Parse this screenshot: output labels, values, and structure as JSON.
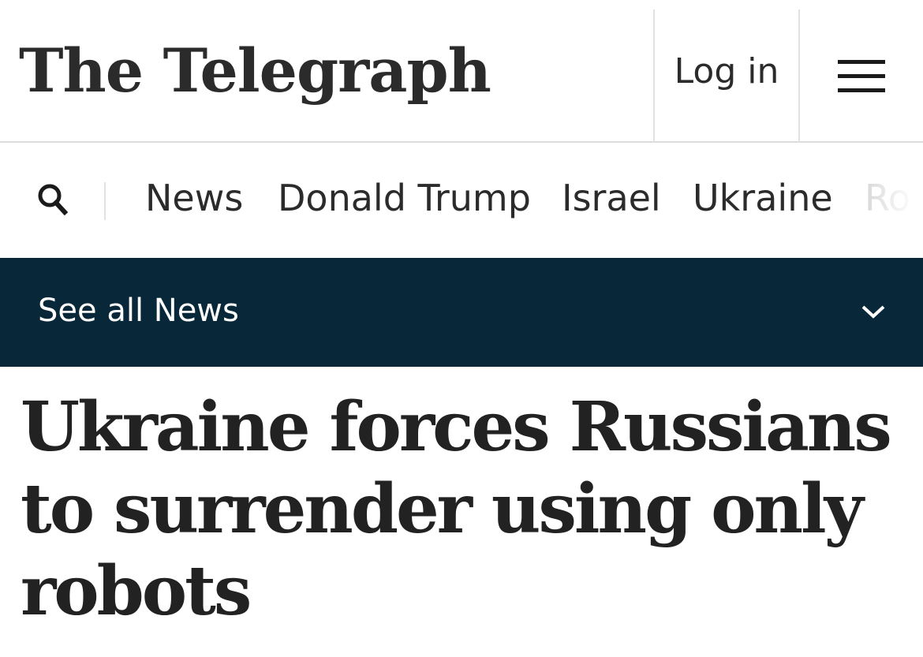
{
  "header": {
    "logo_text": "The Telegraph",
    "login_label": "Log in",
    "menu_icon": "hamburger-menu-icon"
  },
  "nav": {
    "search_icon": "search-icon",
    "items": [
      {
        "label": "News"
      },
      {
        "label": "Donald Trump"
      },
      {
        "label": "Israel"
      },
      {
        "label": "Ukraine"
      },
      {
        "label": "Ro"
      }
    ]
  },
  "section": {
    "label": "See all News",
    "chevron_icon": "chevron-down-icon"
  },
  "article": {
    "headline": "Ukraine forces Russians to surrender using only robots"
  },
  "colors": {
    "section_bar_bg": "#08283a",
    "text": "#222222"
  }
}
